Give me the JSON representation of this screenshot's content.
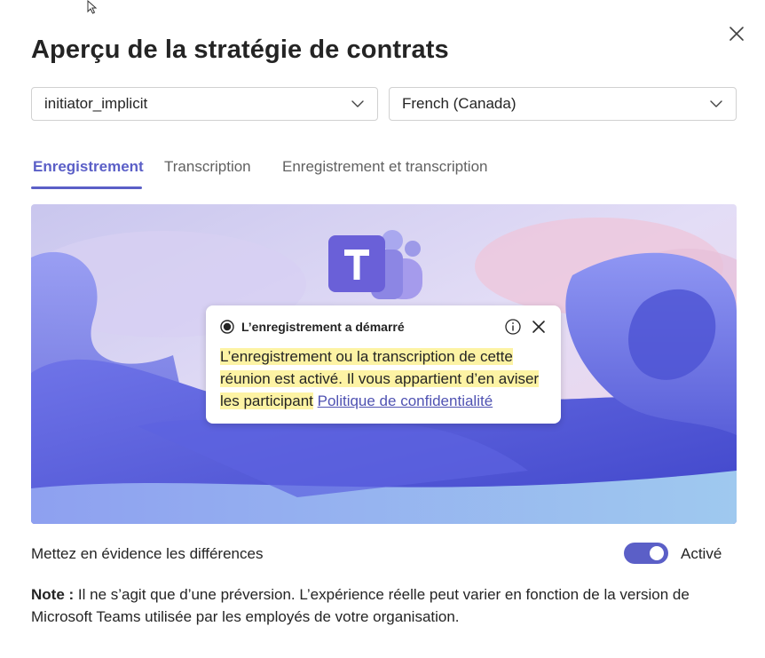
{
  "dialog": {
    "title": "Aperçu de la stratégie de contrats",
    "close_icon": "close-icon"
  },
  "selects": {
    "policy": {
      "value": "initiator_implicit",
      "icon": "chevron-down-icon"
    },
    "language": {
      "value": "French (Canada)",
      "icon": "chevron-down-icon"
    }
  },
  "tabs": [
    {
      "label": "Enregistrement",
      "active": true
    },
    {
      "label": "Transcription",
      "active": false
    },
    {
      "label": "Enregistrement et transcription",
      "active": false
    }
  ],
  "preview": {
    "logo": "teams-logo",
    "toast": {
      "title": "L’enregistrement a démarré",
      "body_highlighted": "L’enregistrement ou la transcription de cette réunion est activé. Il vous appartient d’en aviser les participant",
      "link": "Politique de confidentialité",
      "icons": [
        "record-icon",
        "info-icon",
        "close-icon"
      ]
    }
  },
  "highlight_toggle": {
    "label": "Mettez en évidence les différences",
    "state_label": "Activé",
    "on": true
  },
  "note": {
    "prefix": "Note :",
    "text": " Il ne s’agit que d’une préversion. L’expérience réelle peut varier en fonction de la version de Microsoft Teams utilisée par les employés de votre organisation."
  },
  "colors": {
    "accent": "#5b5fc7",
    "link": "#4f52b2",
    "highlight": "#fdf3a4"
  }
}
